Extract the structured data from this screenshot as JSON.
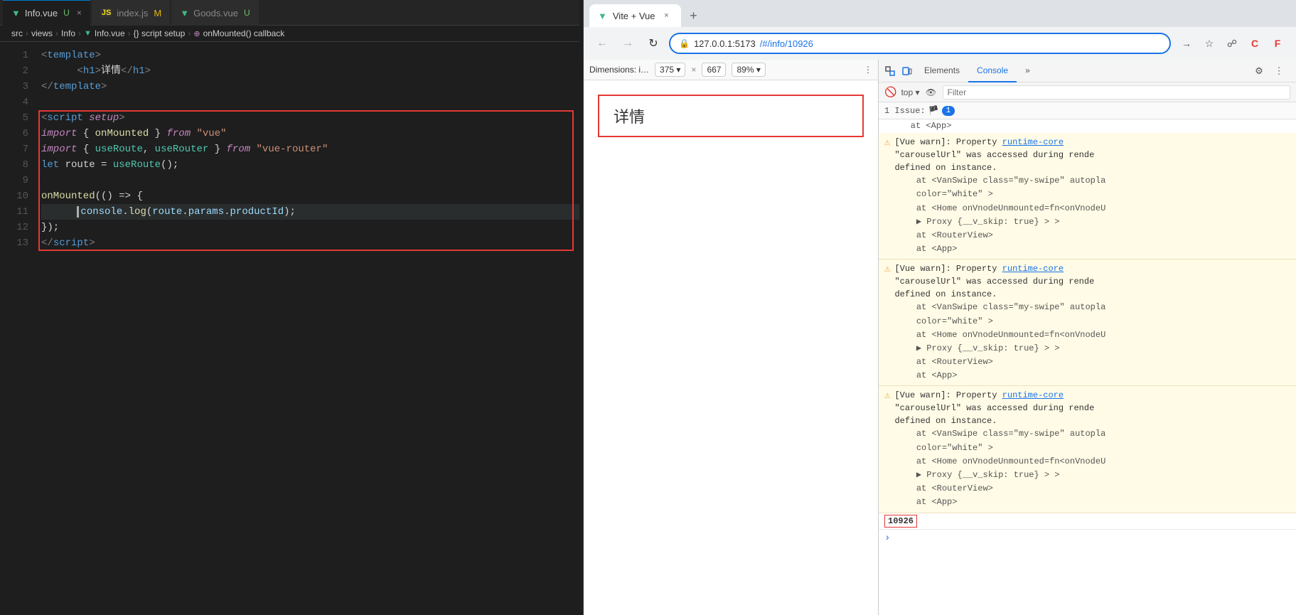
{
  "editor": {
    "tabs": [
      {
        "id": "info-vue",
        "label": "Info.vue",
        "type": "vue",
        "active": true,
        "modified": false,
        "closable": true,
        "indicator": "U"
      },
      {
        "id": "index-js",
        "label": "index.js",
        "type": "js",
        "active": false,
        "modified": true,
        "closable": false,
        "indicator": "M"
      },
      {
        "id": "goods-vue",
        "label": "Goods.vue",
        "type": "vue",
        "active": false,
        "modified": false,
        "closable": false,
        "indicator": "U"
      }
    ],
    "breadcrumb": {
      "parts": [
        "src",
        ">",
        "views",
        ">",
        "Info",
        ">",
        "Info.vue",
        ">",
        "{} script setup",
        ">",
        "onMounted() callback"
      ]
    },
    "lines": [
      {
        "num": 1,
        "content": "template_open"
      },
      {
        "num": 2,
        "content": "h1_open"
      },
      {
        "num": 3,
        "content": "template_close"
      },
      {
        "num": 4,
        "content": "empty"
      },
      {
        "num": 5,
        "content": "script_open"
      },
      {
        "num": 6,
        "content": "import_onmounted"
      },
      {
        "num": 7,
        "content": "import_router"
      },
      {
        "num": 8,
        "content": "let_route"
      },
      {
        "num": 9,
        "content": "empty"
      },
      {
        "num": 10,
        "content": "onmounted_start"
      },
      {
        "num": 11,
        "content": "console_log",
        "active": true
      },
      {
        "num": 12,
        "content": "close_brace"
      },
      {
        "num": 13,
        "content": "script_close"
      }
    ]
  },
  "browser": {
    "tab_label": "Vite + Vue",
    "tab_close": "×",
    "nav": {
      "back_disabled": true,
      "forward_disabled": true
    },
    "address": {
      "url_prefix": "127.0.0.1:5173",
      "url_highlight": "/#/info/10926"
    },
    "toolbar_buttons": [
      "share",
      "star",
      "extensions",
      "C-icon",
      "F-icon"
    ],
    "devtools": {
      "dimensions_label": "Dimensions: i…",
      "width": "375",
      "x_label": "×",
      "height": "667",
      "zoom_label": "89%",
      "tabs": [
        "Elements",
        "Console"
      ],
      "active_tab": "Console",
      "console_top_label": "top",
      "filter_placeholder": "Filter",
      "issue_label": "1 Issue:",
      "issue_count": "1",
      "warnings": [
        {
          "text_before": "[Vue warn]: Property ",
          "link": "runtime-core",
          "text_after": "\n\"carouselUrl\" was accessed during rende\ndefined on instance.",
          "indent_lines": [
            "at <VanSwipe class=\"my-swipe\" autopla",
            "color=\"white\" >",
            "at <Home onVnodeUnmounted=fn<onVnodeU",
            "▶ Proxy {__v_skip: true} > >",
            "at <RouterView>",
            "at <App>"
          ]
        },
        {
          "text_before": "[Vue warn]: Property ",
          "link": "runtime-core",
          "text_after": "\n\"carouselUrl\" was accessed during rende\ndefined on instance.",
          "indent_lines": [
            "at <VanSwipe class=\"my-swipe\" autopla",
            "color=\"white\" >",
            "at <Home onVnodeUnmounted=fn<onVnodeU",
            "▶ Proxy {__v_skip: true} > >",
            "at <RouterView>",
            "at <App>"
          ]
        },
        {
          "text_before": "[Vue warn]: Property ",
          "link": "runtime-core",
          "text_after": "\n\"carouselUrl\" was accessed during rende\ndefined on instance.",
          "indent_lines": [
            "at <VanSwipe class=\"my-swipe\" autopla",
            "color=\"white\" >",
            "at <Home onVnodeUnmounted=fn<onVnodeU",
            "▶ Proxy {__v_skip: true} > >",
            "at <RouterView>",
            "at <App>"
          ]
        }
      ],
      "output_value": "10926"
    }
  },
  "viewport": {
    "detail_text": "详情"
  }
}
